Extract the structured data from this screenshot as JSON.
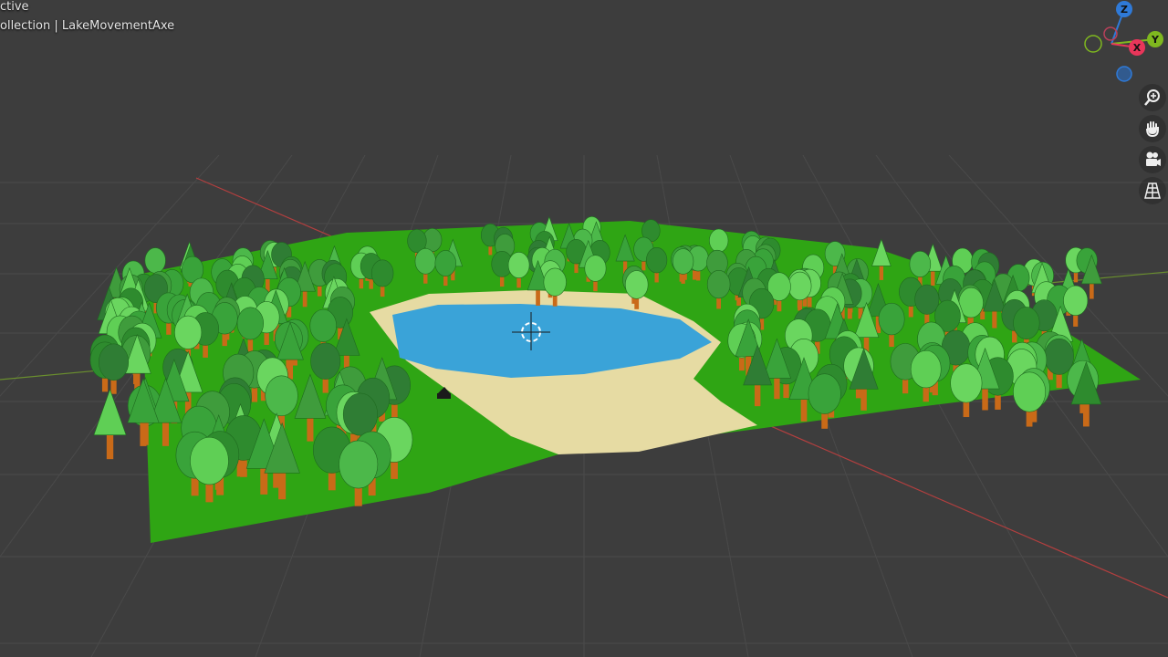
{
  "viewport": {
    "mode_text": "ctive",
    "collection_text": "ollection | LakeMovementAxe"
  },
  "gizmo": {
    "z_label": "Z",
    "y_label": "Y",
    "x_label": "X",
    "z_color": "#2f7ad8",
    "y_color": "#7fb81f",
    "x_color": "#e8365a"
  },
  "nav_buttons": [
    "zoom-icon",
    "hand-pan-icon",
    "camera-icon",
    "grid-perspective-icon"
  ],
  "colors": {
    "background": "#3d3d3d",
    "grass": "#2fa514",
    "sand": "#e6dba3",
    "water": "#3aa3d8",
    "x_axis_line": "#b33f3f",
    "y_axis_line": "#6a8f2e"
  }
}
